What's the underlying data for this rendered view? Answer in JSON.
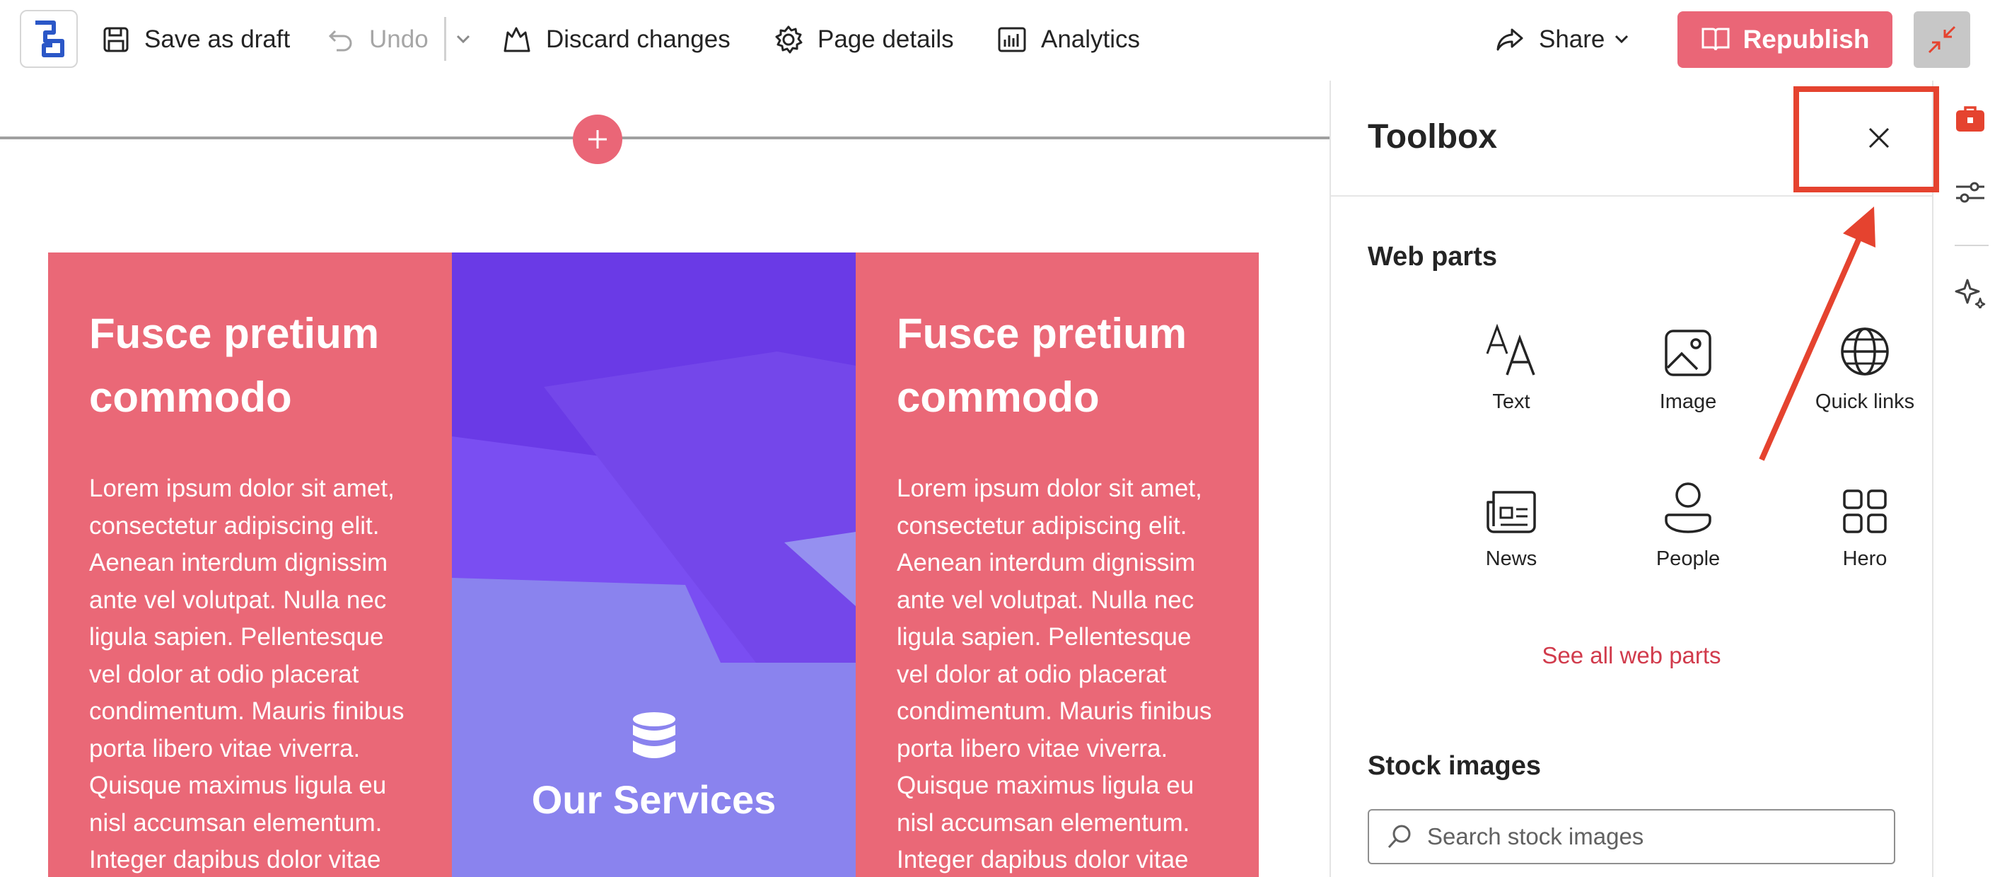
{
  "toolbar": {
    "save_draft": "Save as draft",
    "undo": "Undo",
    "discard": "Discard changes",
    "page_details": "Page details",
    "analytics": "Analytics",
    "share": "Share",
    "republish": "Republish"
  },
  "canvas": {
    "columns": [
      {
        "heading": "Fusce pretium commodo",
        "body": "Lorem ipsum dolor sit amet, consectetur adipiscing elit. Aenean interdum dignissim ante vel volutpat. Nulla nec ligula sapien. Pellentesque vel dolor at odio placerat condimentum. Mauris finibus porta libero vitae viverra. Quisque maximus ligula eu nisl accumsan elementum. Integer dapibus dolor vitae"
      },
      {
        "label": "Our Services",
        "icon": "database-icon"
      },
      {
        "heading": "Fusce pretium commodo",
        "body": "Lorem ipsum dolor sit amet, consectetur adipiscing elit. Aenean interdum dignissim ante vel volutpat. Nulla nec ligula sapien. Pellentesque vel dolor at odio placerat condimentum. Mauris finibus porta libero vitae viverra. Quisque maximus ligula eu nisl accumsan elementum. Integer dapibus dolor vitae"
      }
    ]
  },
  "toolbox": {
    "title": "Toolbox",
    "web_parts_heading": "Web parts",
    "web_parts": [
      {
        "label": "Text",
        "icon": "text-icon"
      },
      {
        "label": "Image",
        "icon": "image-icon"
      },
      {
        "label": "Quick links",
        "icon": "globe-icon"
      },
      {
        "label": "News",
        "icon": "news-icon"
      },
      {
        "label": "People",
        "icon": "person-icon"
      },
      {
        "label": "Hero",
        "icon": "hero-grid-icon"
      }
    ],
    "see_all": "See all web parts",
    "stock_heading": "Stock images",
    "stock_placeholder": "Search stock images"
  },
  "colors": {
    "accent": "#ea6677",
    "link": "#d13b4c",
    "annotation": "#e5432f"
  }
}
